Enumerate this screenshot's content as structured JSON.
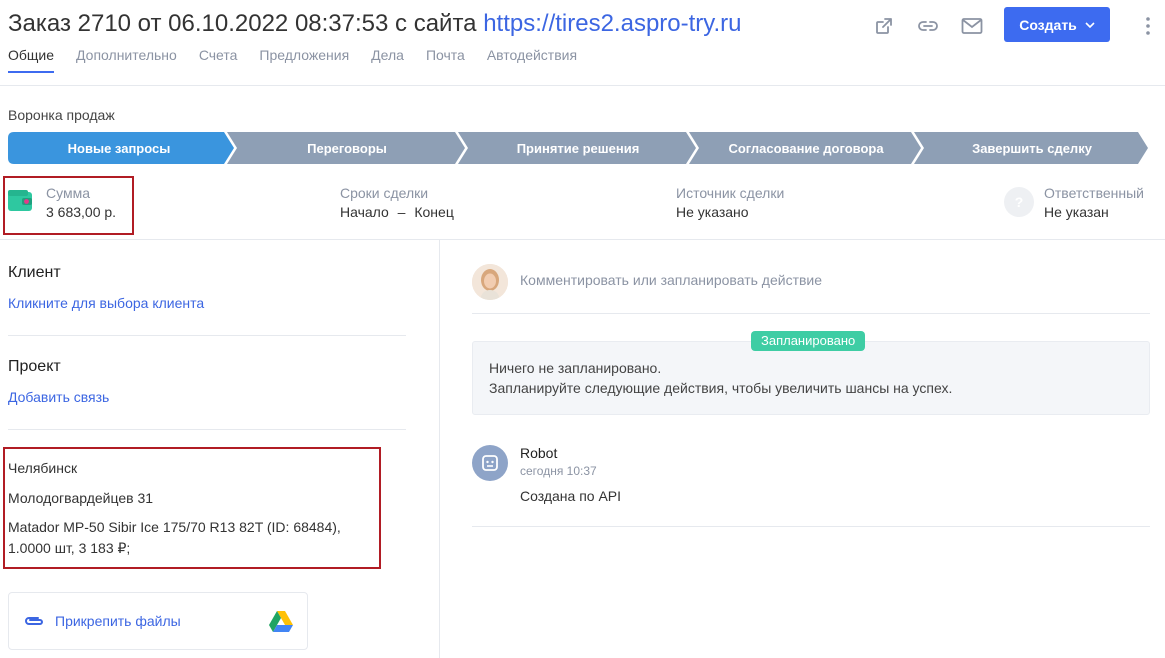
{
  "header": {
    "title_prefix": "Заказ 2710 от 06.10.2022 08:37:53 с сайта ",
    "title_link": "https://tires2.aspro-try.ru",
    "icons": [
      "open-external-icon",
      "link-icon",
      "mail-icon"
    ],
    "create_label": "Создать",
    "more_icon": "vertical-dots-icon"
  },
  "tabs": [
    {
      "label": "Общие",
      "active": true
    },
    {
      "label": "Дополнительно",
      "active": false
    },
    {
      "label": "Счета",
      "active": false
    },
    {
      "label": "Предложения",
      "active": false
    },
    {
      "label": "Дела",
      "active": false
    },
    {
      "label": "Почта",
      "active": false
    },
    {
      "label": "Автодействия",
      "active": false
    }
  ],
  "funnel": {
    "label": "Воронка продаж",
    "stages": [
      {
        "label": "Новые запросы",
        "active": true
      },
      {
        "label": "Переговоры",
        "active": false
      },
      {
        "label": "Принятие решения",
        "active": false
      },
      {
        "label": "Согласование договора",
        "active": false
      },
      {
        "label": "Завершить сделку",
        "active": false
      }
    ]
  },
  "info": {
    "sum_label": "Сумма",
    "sum_value": "3 683,00 р.",
    "terms_label": "Сроки сделки",
    "terms_start": "Начало",
    "terms_sep": "–",
    "terms_end": "Конец",
    "source_label": "Источник сделки",
    "source_value": "Не указано",
    "responsible_label": "Ответственный",
    "responsible_value": "Не указан",
    "responsible_avatar": "?"
  },
  "client": {
    "title": "Клиент",
    "link": "Кликните для выбора клиента"
  },
  "project": {
    "title": "Проект",
    "link": "Добавить связь"
  },
  "address": {
    "city": "Челябинск",
    "street": "Молодогвардейцев 31",
    "product_line1": "Matador MP-50 Sibir Ice 175/70 R13 82T (ID: 68484),",
    "product_line2": "1.0000 шт, 3 183 ₽;"
  },
  "attach": {
    "label": "Прикрепить файлы",
    "icon": "paperclip-icon",
    "drive_icon": "google-drive-icon"
  },
  "feed": {
    "comment_prompt": "Комментировать или запланировать действие",
    "planned_badge": "Запланировано",
    "planned_line1": "Ничего не запланировано.",
    "planned_line2": "Запланируйте следующие действия, чтобы увеличить шансы на успех.",
    "robot_name": "Robot",
    "robot_time": "сегодня 10:37",
    "robot_msg": "Создана по API"
  },
  "colors": {
    "accent": "#3d6bf0",
    "stage_active": "#3a95de",
    "stage_inactive": "#8e9fb5",
    "badge": "#3ecda4",
    "highlight": "#b11c24"
  }
}
